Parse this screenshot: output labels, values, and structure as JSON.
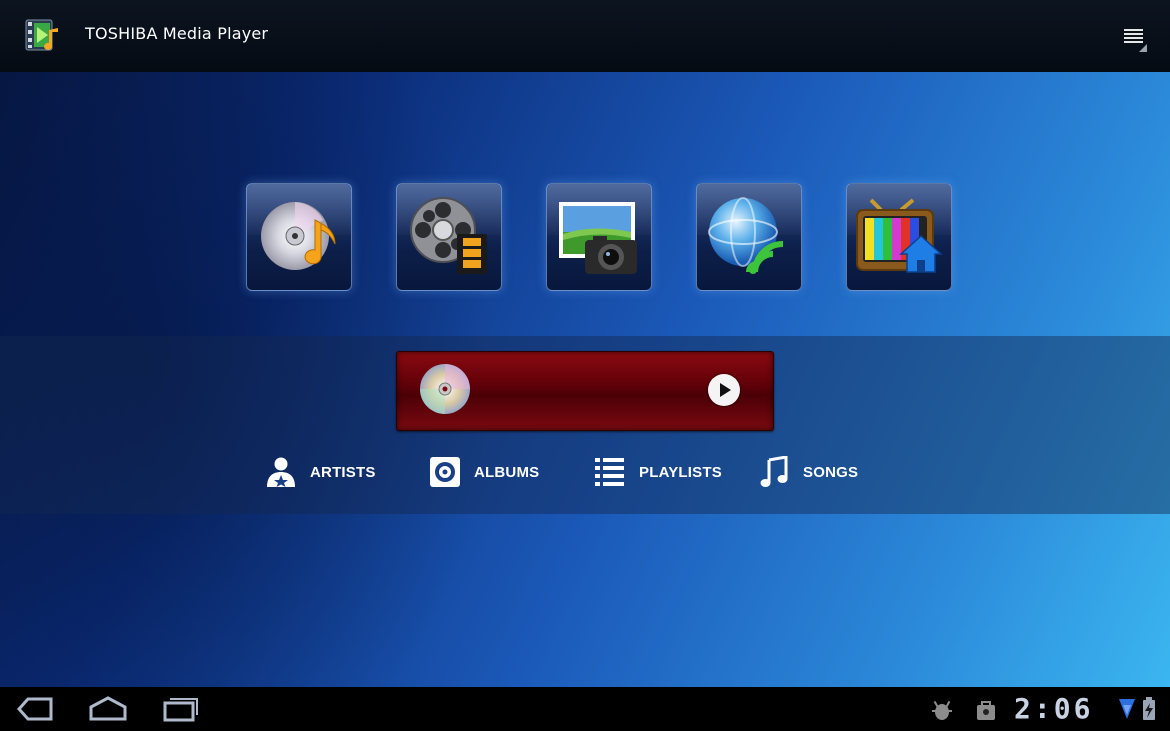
{
  "app": {
    "title": "TOSHIBA Media Player",
    "icon": "media-player-app-icon",
    "menu_icon": "overflow-menu-icon"
  },
  "tiles": [
    {
      "name": "music-tile",
      "icon": "cd-music-icon"
    },
    {
      "name": "video-tile",
      "icon": "film-reel-icon"
    },
    {
      "name": "photo-tile",
      "icon": "photo-camera-icon"
    },
    {
      "name": "network-media-tile",
      "icon": "globe-wireless-icon"
    },
    {
      "name": "tv-home-tile",
      "icon": "tv-home-icon"
    }
  ],
  "now_playing": {
    "icon": "cd-icon",
    "play_icon": "play-icon",
    "bar_color": "#6b0009"
  },
  "categories": {
    "artists": "ARTISTS",
    "albums": "ALBUMS",
    "playlists": "PLAYLISTS",
    "songs": "SONGS"
  },
  "navigation": {
    "back_icon": "back-icon",
    "home_icon": "home-icon",
    "recent_apps_icon": "recent-apps-icon"
  },
  "status_bar": {
    "time": "2:06",
    "icons": [
      "usb-debug-icon",
      "store-notification-icon",
      "wifi-icon",
      "battery-charging-icon"
    ]
  },
  "colors": {
    "background_dark": "#071845",
    "background_light": "#3bb6f0",
    "accent_red": "#8b0a10"
  }
}
